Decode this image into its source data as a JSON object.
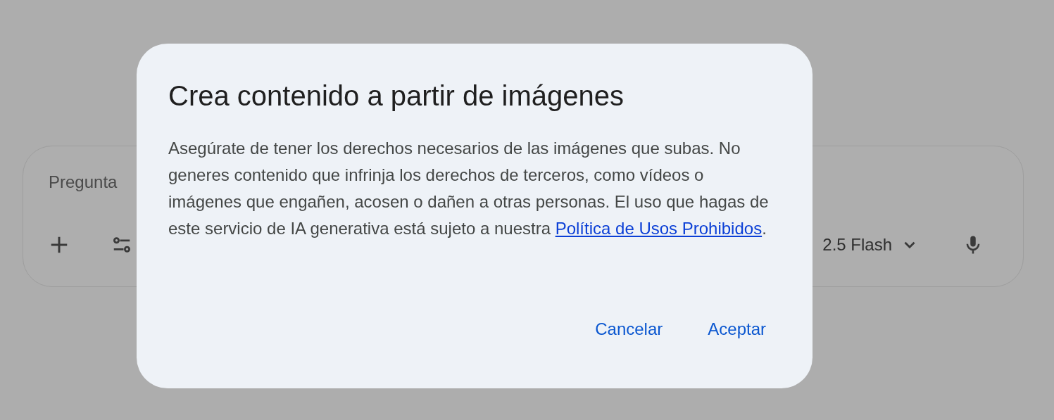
{
  "input": {
    "placeholder": "Pregunta",
    "model": "2.5 Flash"
  },
  "dialog": {
    "title": "Crea contenido a partir de imágenes",
    "body": "Asegúrate de tener los derechos necesarios de las imágenes que subas. No generes contenido que infrinja los derechos de terceros, como vídeos o imágenes que engañen, acosen o dañen a otras personas. El uso que hagas de este servicio de IA generativa está sujeto a nuestra",
    "link": "Política de Usos Prohibidos",
    "body_end": ".",
    "buttons": [
      "Cancelar",
      "Aceptar"
    ]
  }
}
